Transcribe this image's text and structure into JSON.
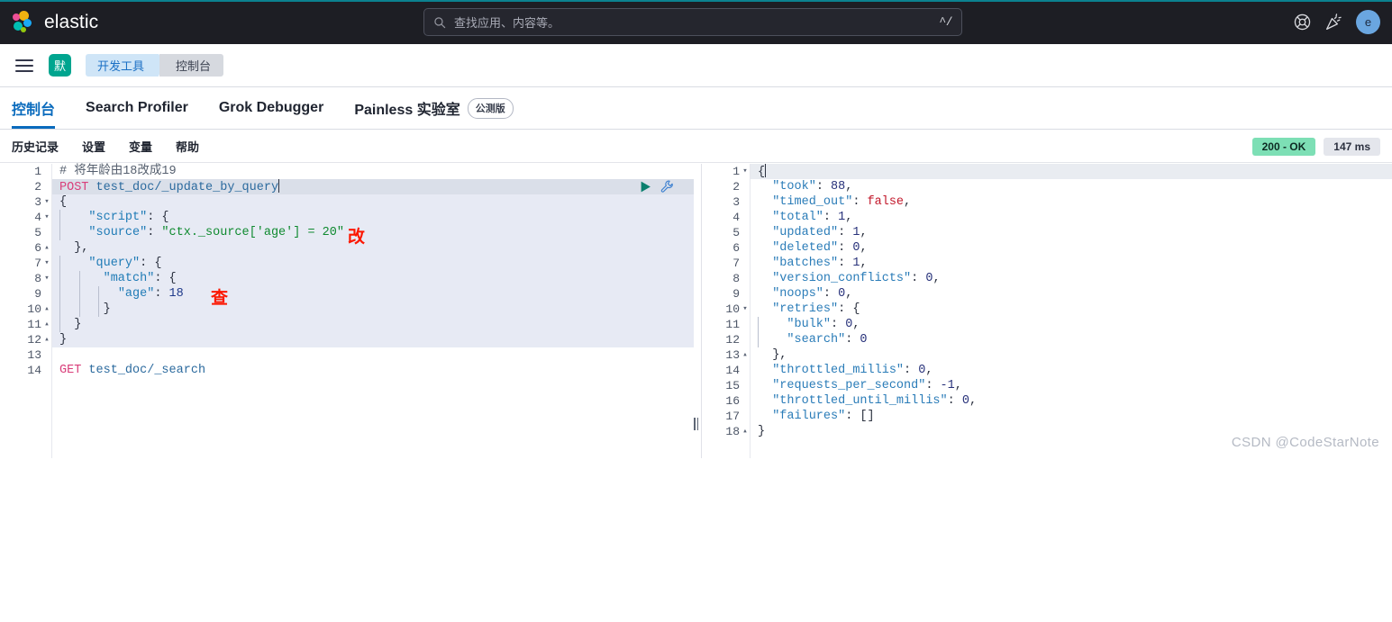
{
  "topbar": {
    "brand": "elastic",
    "brand_logo_icon": "elastic-logo-icon",
    "search": {
      "placeholder": "查找应用、内容等。",
      "icon": "search-icon",
      "shortcut": "^/"
    },
    "help_icon": "help-lifebuoy-icon",
    "news_icon": "news-announcement-icon",
    "avatar_initial": "e"
  },
  "breadcrumb_bar": {
    "menu_icon": "hamburger-menu-icon",
    "space_badge": "默",
    "crumbs": [
      {
        "label": "开发工具"
      },
      {
        "label": "控制台"
      }
    ]
  },
  "tabs": [
    {
      "label": "控制台",
      "active": true
    },
    {
      "label": "Search Profiler",
      "active": false
    },
    {
      "label": "Grok Debugger",
      "active": false
    },
    {
      "label": "Painless 实验室",
      "active": false,
      "badge": "公测版"
    }
  ],
  "submenu": [
    {
      "label": "历史记录"
    },
    {
      "label": "设置"
    },
    {
      "label": "变量"
    },
    {
      "label": "帮助"
    }
  ],
  "status": {
    "code": "200 - OK",
    "time": "147 ms"
  },
  "editor": {
    "run_icon": "play-run-icon",
    "wrench_icon": "wrench-tools-icon",
    "annotations": [
      {
        "text": "改",
        "line": 5
      },
      {
        "text": "查",
        "line": 9
      }
    ],
    "lines": [
      {
        "n": "1",
        "fold": "",
        "text": "# 将年龄由18改成19"
      },
      {
        "n": "2",
        "fold": "",
        "text": "POST test_doc/_update_by_query"
      },
      {
        "n": "3",
        "fold": "▾",
        "text": "{"
      },
      {
        "n": "4",
        "fold": "▾",
        "text": "    \"script\": {"
      },
      {
        "n": "5",
        "fold": "",
        "text": "    \"source\": \"ctx._source['age'] = 20\""
      },
      {
        "n": "6",
        "fold": "▴",
        "text": "  },"
      },
      {
        "n": "7",
        "fold": "▾",
        "text": "    \"query\": {"
      },
      {
        "n": "8",
        "fold": "▾",
        "text": "      \"match\": {"
      },
      {
        "n": "9",
        "fold": "",
        "text": "        \"age\": 18"
      },
      {
        "n": "10",
        "fold": "▴",
        "text": "      }"
      },
      {
        "n": "11",
        "fold": "▴",
        "text": "  }"
      },
      {
        "n": "12",
        "fold": "▴",
        "text": "}"
      },
      {
        "n": "13",
        "fold": "",
        "text": ""
      },
      {
        "n": "14",
        "fold": "",
        "text": "GET test_doc/_search"
      }
    ]
  },
  "response": {
    "lines": [
      {
        "n": "1",
        "fold": "▾",
        "text": "{"
      },
      {
        "n": "2",
        "fold": "",
        "text": "  \"took\": 88,"
      },
      {
        "n": "3",
        "fold": "",
        "text": "  \"timed_out\": false,"
      },
      {
        "n": "4",
        "fold": "",
        "text": "  \"total\": 1,"
      },
      {
        "n": "5",
        "fold": "",
        "text": "  \"updated\": 1,"
      },
      {
        "n": "6",
        "fold": "",
        "text": "  \"deleted\": 0,"
      },
      {
        "n": "7",
        "fold": "",
        "text": "  \"batches\": 1,"
      },
      {
        "n": "8",
        "fold": "",
        "text": "  \"version_conflicts\": 0,"
      },
      {
        "n": "9",
        "fold": "",
        "text": "  \"noops\": 0,"
      },
      {
        "n": "10",
        "fold": "▾",
        "text": "  \"retries\": {"
      },
      {
        "n": "11",
        "fold": "",
        "text": "    \"bulk\": 0,"
      },
      {
        "n": "12",
        "fold": "",
        "text": "    \"search\": 0"
      },
      {
        "n": "13",
        "fold": "▴",
        "text": "  },"
      },
      {
        "n": "14",
        "fold": "",
        "text": "  \"throttled_millis\": 0,"
      },
      {
        "n": "15",
        "fold": "",
        "text": "  \"requests_per_second\": -1,"
      },
      {
        "n": "16",
        "fold": "",
        "text": "  \"throttled_until_millis\": 0,"
      },
      {
        "n": "17",
        "fold": "",
        "text": "  \"failures\": []"
      },
      {
        "n": "18",
        "fold": "▴",
        "text": "}"
      }
    ]
  },
  "watermark": "CSDN @CodeStarNote",
  "colors": {
    "topbar_bg": "#1d1e24",
    "accent_teal": "#0b8290",
    "link_blue": "#0a6bbd",
    "ok_green": "#7ddfb5",
    "annotation_red": "#fc1700",
    "space_badge_teal": "#00a58f"
  }
}
